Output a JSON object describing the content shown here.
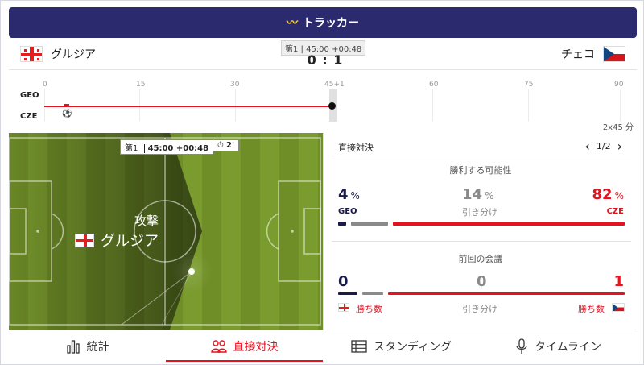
{
  "header": {
    "title": "トラッカー",
    "icon": "tracker-icon"
  },
  "match": {
    "home": {
      "name": "グルジア",
      "code": "GEO"
    },
    "away": {
      "name": "チェコ",
      "code": "CZE"
    },
    "period": "第1 | 45:00 +00:48",
    "score": "0 : 1"
  },
  "timeline": {
    "ticks": [
      "0",
      "15",
      "30",
      "45+1",
      "60",
      "75",
      "90"
    ],
    "rows": [
      "GEO",
      "CZE"
    ],
    "duration": "2x45 分",
    "accent": "#e5121f"
  },
  "pitch": {
    "period_label": "第1",
    "clock": "45:00 +00:48",
    "added_time": "2'",
    "attack_label": "攻撃",
    "attacking_team": "グルジア"
  },
  "h2h": {
    "header": "直接対決",
    "pager": "1/2",
    "win_prob": {
      "title": "勝利する可能性",
      "home_pct": "4",
      "draw_pct": "14",
      "away_pct": "82",
      "pct_sign": "%",
      "home_code": "GEO",
      "draw_label": "引き分け",
      "away_code": "CZE",
      "home_color": "#1b1b4b",
      "draw_color": "#8a8a8a",
      "away_color": "#e5121f"
    },
    "previous": {
      "title": "前回の会議",
      "home_wins": "0",
      "draws": "0",
      "away_wins": "1",
      "win_label": "勝ち数",
      "draw_label": "引き分け"
    }
  },
  "nav": {
    "items": [
      {
        "label": "統計",
        "icon": "stats-icon"
      },
      {
        "label": "直接対決",
        "icon": "h2h-icon"
      },
      {
        "label": "スタンディング",
        "icon": "standings-icon"
      },
      {
        "label": "タイムライン",
        "icon": "timeline-mic-icon"
      }
    ],
    "active": "直接対決"
  }
}
